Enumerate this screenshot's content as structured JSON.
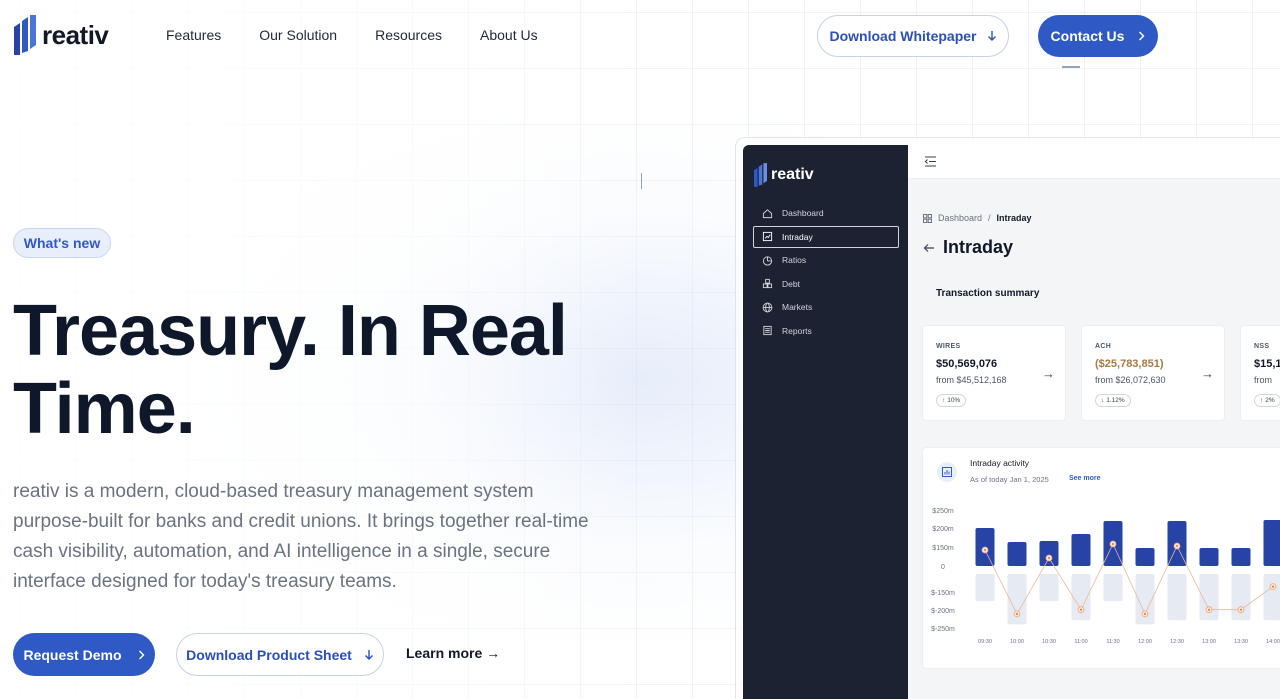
{
  "brand": {
    "name": "reativ"
  },
  "nav": {
    "links": [
      "Features",
      "Our Solution",
      "Resources",
      "About Us"
    ],
    "whitepaper_label": "Download Whitepaper",
    "contact_label": "Contact Us"
  },
  "hero": {
    "badge": "What's new",
    "title_line1": "Treasury. In Real",
    "title_line2": "Time.",
    "description": "reativ is a modern, cloud-based treasury management system purpose-built for banks and credit unions. It brings together real-time cash visibility, automation, and AI intelligence in a single, secure interface designed for today's treasury teams.",
    "demo_label": "Request Demo",
    "sheet_label": "Download Product Sheet",
    "learn_more": "Learn more →"
  },
  "app": {
    "brand": "reativ",
    "sidebar": [
      {
        "label": "Dashboard",
        "icon": "home-icon",
        "active": false
      },
      {
        "label": "Intraday",
        "icon": "chart-icon",
        "active": true
      },
      {
        "label": "Ratios",
        "icon": "pie-icon",
        "active": false
      },
      {
        "label": "Debt",
        "icon": "stack-icon",
        "active": false
      },
      {
        "label": "Markets",
        "icon": "globe-icon",
        "active": false
      },
      {
        "label": "Reports",
        "icon": "report-icon",
        "active": false
      }
    ],
    "breadcrumb": {
      "root": "Dashboard",
      "separator": "/",
      "current": "Intraday"
    },
    "page_title": "Intraday",
    "summary_title": "Transaction summary",
    "cards": [
      {
        "label": "WIRES",
        "value": "$50,569,076",
        "from": "from $45,512,168",
        "change": "10%",
        "direction": "up",
        "negative": false
      },
      {
        "label": "ACH",
        "value": "($25,783,851)",
        "from": "from $26,072,630",
        "change": "1.12%",
        "direction": "down",
        "negative": true
      },
      {
        "label": "NSS",
        "value": "$15,1",
        "from": "from",
        "change": "2%",
        "direction": "up",
        "negative": false
      }
    ],
    "activity": {
      "title": "Intraday activity",
      "subtitle": "As of today Jan 1, 2025",
      "see_more": "See more"
    }
  },
  "chart_data": {
    "type": "bar",
    "title": "Intraday activity",
    "categories": [
      "09:30",
      "10:00",
      "10:30",
      "11:00",
      "11:30",
      "12:00",
      "12:30",
      "13:00",
      "13:30",
      "14:00"
    ],
    "series": [
      {
        "values": [
          190,
          120,
          125,
          160,
          225,
          90,
          225,
          90,
          90,
          230
        ]
      },
      {
        "values": [
          -130,
          -240,
          -130,
          -220,
          -130,
          -240,
          -220,
          -220,
          -220,
          -220
        ]
      }
    ],
    "line_points": [
      80,
      -190,
      40,
      -170,
      110,
      -190,
      100,
      -170,
      -170,
      -60
    ],
    "yticks": [
      "$250m",
      "$200m",
      "$150m",
      "0",
      "$-150m",
      "$-200m",
      "$-250m"
    ],
    "ylim": [
      -260,
      260
    ],
    "colors": {
      "positive": "#2743a6",
      "negative": "#e6eaf3",
      "line": "#e9b89a",
      "marker": "#f0a677"
    },
    "grid": false
  },
  "colors": {
    "accent": "#2f5ac6",
    "sidebar": "#1c2231",
    "text": "#0f172a"
  }
}
